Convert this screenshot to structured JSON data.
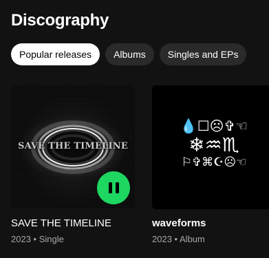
{
  "section": {
    "title": "Discography"
  },
  "filters": [
    {
      "label": "Popular releases",
      "active": true
    },
    {
      "label": "Albums",
      "active": false
    },
    {
      "label": "Singles and EPs",
      "active": false
    }
  ],
  "releases": [
    {
      "name": "SAVE THE TIMELINE",
      "cover_text": "SAVE THE TIMELINE",
      "year": "2023",
      "separator": "•",
      "type": "Single",
      "playing": true,
      "play_icon": "pause-icon"
    },
    {
      "name": "waveforms",
      "cover_glyphs": [
        "💧☐☹✞☜",
        "❄♒♏",
        "⚐✞⌘☪☹☜"
      ],
      "year": "2023",
      "separator": "•",
      "type": "Album",
      "playing": false
    }
  ],
  "colors": {
    "background": "#121212",
    "accent": "#1ed760",
    "chip": "#2a2a2a",
    "chip_active": "#ffffff",
    "subtext": "#a7a7a7"
  }
}
